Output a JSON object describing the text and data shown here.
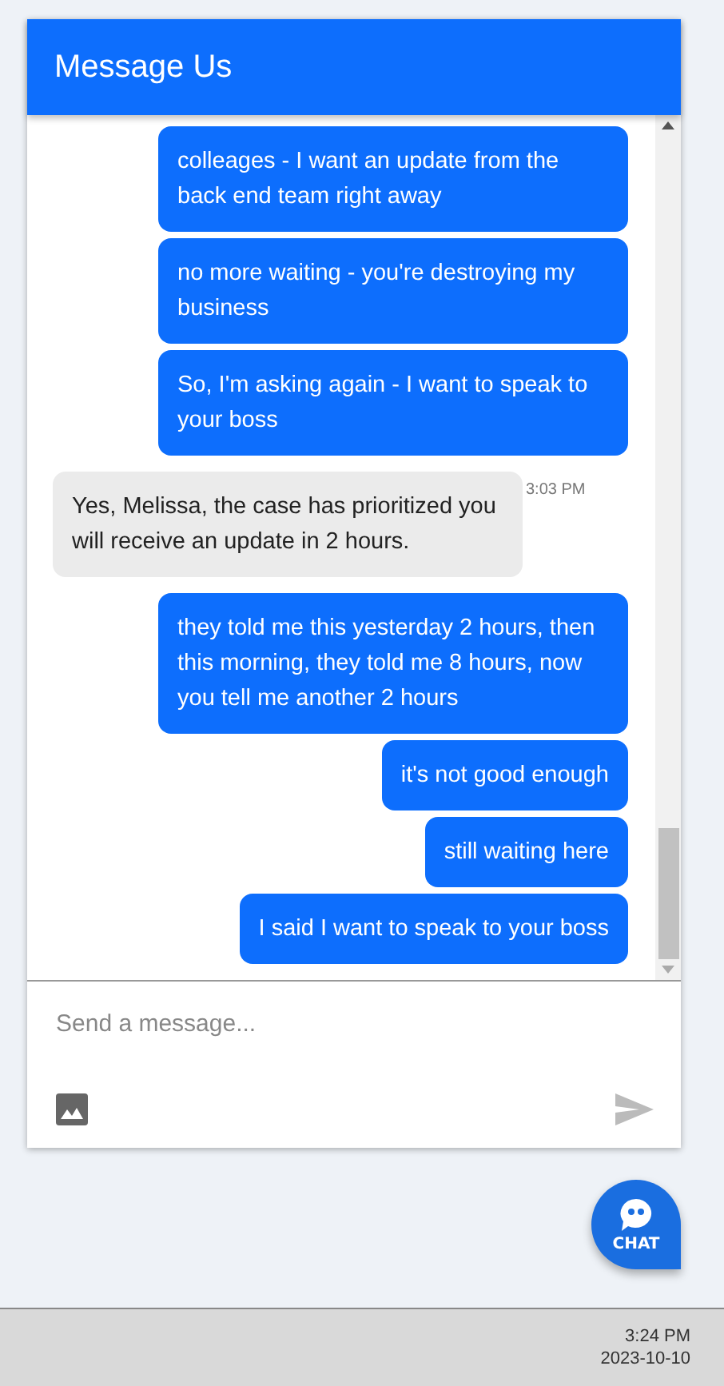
{
  "header": {
    "title": "Message Us"
  },
  "messages": [
    {
      "kind": "user",
      "text": "colleages - I want an update from the back end team right away"
    },
    {
      "kind": "user",
      "text": "no more waiting - you're destroying my business"
    },
    {
      "kind": "user",
      "text": "So, I'm asking again - I want to speak to your boss"
    },
    {
      "kind": "agent",
      "text": "Yes, Melissa, the case has prioritized you will receive an update in 2 hours.",
      "time": "3:03 PM"
    },
    {
      "kind": "user",
      "text": "they told me this yesterday 2 hours, then this morning, they told me 8 hours, now you tell me another 2 hours"
    },
    {
      "kind": "user",
      "text": "it's not good enough"
    },
    {
      "kind": "user",
      "text": "still waiting here"
    },
    {
      "kind": "user",
      "text": "I said I want to speak to your boss"
    }
  ],
  "composer": {
    "placeholder": "Send a message..."
  },
  "chat_button": {
    "label": "CHAT"
  },
  "taskbar": {
    "time": "3:24 PM",
    "date": "2023-10-10"
  }
}
